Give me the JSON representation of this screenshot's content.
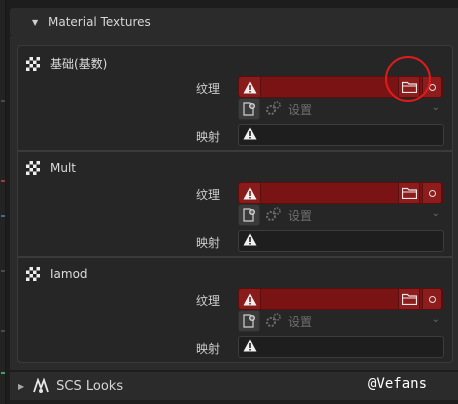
{
  "panel": {
    "title": "Material Textures"
  },
  "textures": [
    {
      "name": "基础(基数)",
      "texture_label": "纹理",
      "setting_placeholder": "设置",
      "mapping_label": "映射"
    },
    {
      "name": "Mult",
      "texture_label": "纹理",
      "setting_placeholder": "设置",
      "mapping_label": "映射"
    },
    {
      "name": "Iamod",
      "texture_label": "纹理",
      "setting_placeholder": "设置",
      "mapping_label": "映射"
    }
  ],
  "footer": {
    "title": "SCS Looks"
  },
  "watermark": "@Vefans",
  "colors": {
    "panel_bg": "#2b2b2b",
    "texture_field_error": "#7a1414",
    "highlight_circle": "#e01b1b"
  },
  "icons": [
    "checker-texture-icon",
    "warning-icon",
    "folder-icon",
    "circle-toggle-icon",
    "new-image-icon",
    "gear-icon",
    "chevron-down-icon",
    "scs-tools-icon"
  ]
}
